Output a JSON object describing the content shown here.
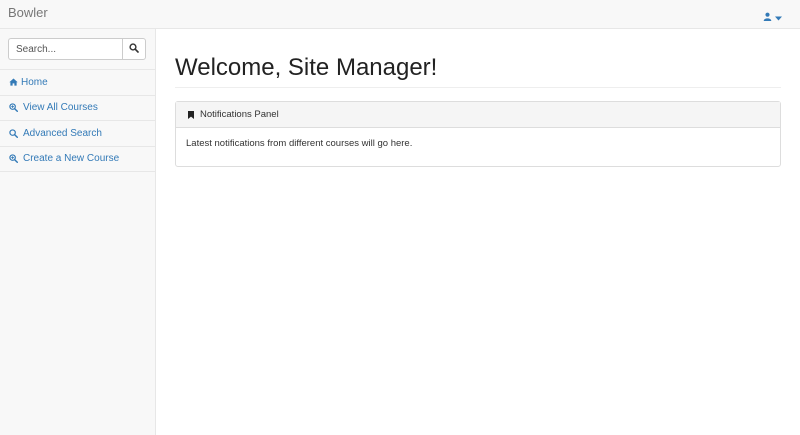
{
  "navbar": {
    "brand": "Bowler",
    "user_icon": "user-icon",
    "caret_icon": "caret-down-icon"
  },
  "sidebar": {
    "search": {
      "placeholder": "Search...",
      "button_icon": "search-icon"
    },
    "items": [
      {
        "label": "Home",
        "icon": "home-icon"
      },
      {
        "label": "View All Courses",
        "icon": "zoom-in-icon"
      },
      {
        "label": "Advanced Search",
        "icon": "search-icon"
      },
      {
        "label": "Create a New Course",
        "icon": "zoom-in-icon"
      }
    ]
  },
  "main": {
    "title": "Welcome, Site Manager!",
    "panel": {
      "heading": "Notifications Panel",
      "heading_icon": "bookmark-icon",
      "body": "Latest notifications from different courses will go here."
    }
  },
  "colors": {
    "link": "#337ab7",
    "navbar_bg": "#f8f8f8",
    "panel_heading_bg": "#f5f5f5"
  }
}
